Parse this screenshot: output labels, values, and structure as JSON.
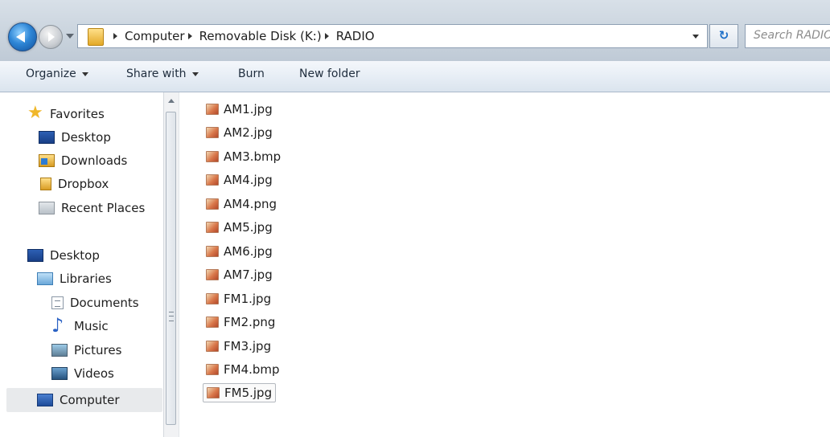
{
  "address_bar": {
    "path": [
      "Computer",
      "Removable Disk (K:)",
      "RADIO"
    ],
    "search_placeholder": "Search RADIO",
    "refresh_glyph": "↻"
  },
  "toolbar": {
    "organize": "Organize",
    "share_with": "Share with",
    "burn": "Burn",
    "new_folder": "New folder"
  },
  "nav": {
    "favorites": "Favorites",
    "favorites_items": [
      "Desktop",
      "Downloads",
      "Dropbox",
      "Recent Places"
    ],
    "desktop": "Desktop",
    "libraries": "Libraries",
    "library_items": [
      "Documents",
      "Music",
      "Pictures",
      "Videos"
    ],
    "computer": "Computer"
  },
  "files": [
    "AM1.jpg",
    "AM2.jpg",
    "AM3.bmp",
    "AM4.jpg",
    "AM4.png",
    "AM5.jpg",
    "AM6.jpg",
    "AM7.jpg",
    "FM1.jpg",
    "FM2.png",
    "FM3.jpg",
    "FM4.bmp",
    "FM5.jpg"
  ],
  "focused_file": "FM5.jpg",
  "colors": {
    "accent": "#2e86d6",
    "selection": "#e8eaec",
    "folder": "#e3a928"
  }
}
